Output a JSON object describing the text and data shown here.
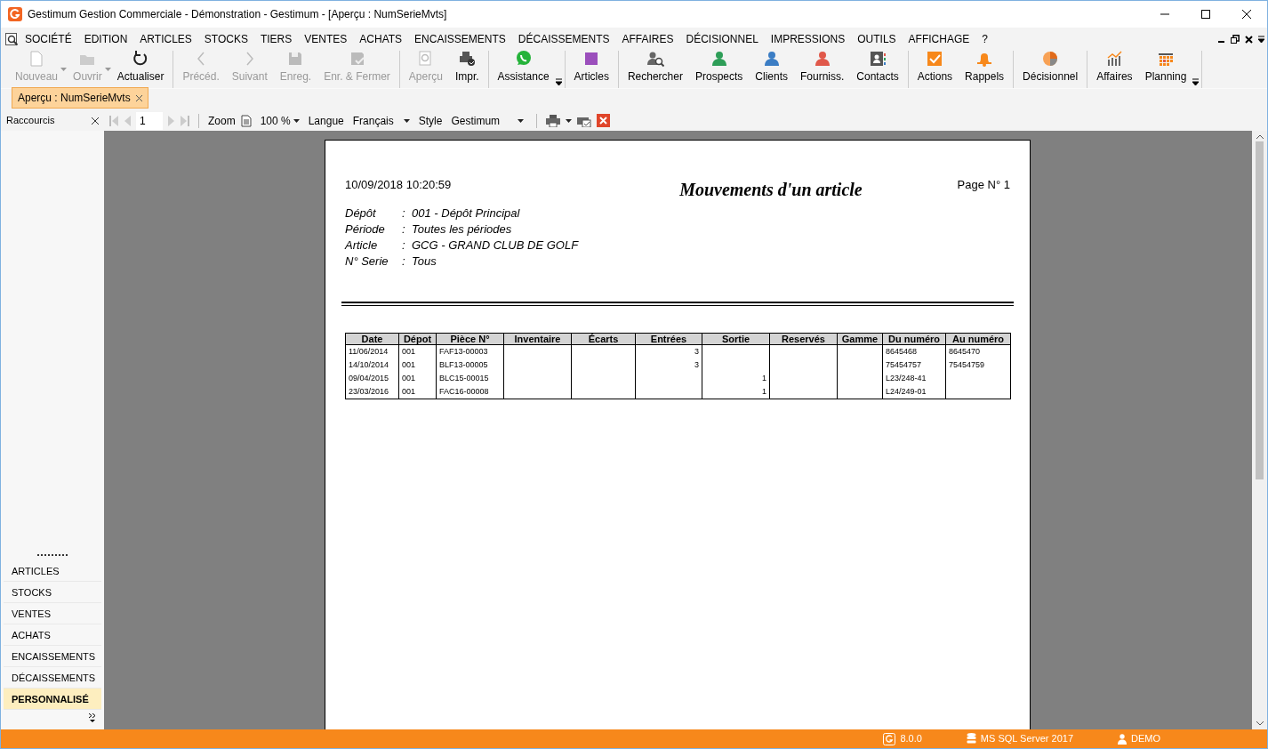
{
  "window": {
    "title": "Gestimum Gestion Commerciale - Démonstration - Gestimum - [Aperçu : NumSerieMvts]"
  },
  "menu": [
    "SOCIÉTÉ",
    "EDITION",
    "ARTICLES",
    "STOCKS",
    "TIERS",
    "VENTES",
    "ACHATS",
    "ENCAISSEMENTS",
    "DÉCAISSEMENTS",
    "AFFAIRES",
    "DÉCISIONNEL",
    "IMPRESSIONS",
    "OUTILS",
    "AFFICHAGE",
    "?"
  ],
  "toolbar": {
    "groups": [
      [
        {
          "label": "Nouveau",
          "disabled": true,
          "dropdown": true
        },
        {
          "label": "Ouvrir",
          "disabled": true,
          "dropdown": true
        },
        {
          "label": "Actualiser",
          "disabled": false,
          "dropdown": false
        }
      ],
      [
        {
          "label": "Précéd.",
          "disabled": true,
          "dropdown": false
        },
        {
          "label": "Suivant",
          "disabled": true,
          "dropdown": false
        },
        {
          "label": "Enreg.",
          "disabled": true,
          "dropdown": false
        },
        {
          "label": "Enr. & Fermer",
          "disabled": true,
          "dropdown": false
        }
      ],
      [
        {
          "label": "Aperçu",
          "disabled": true,
          "dropdown": false
        },
        {
          "label": "Impr.",
          "disabled": false,
          "dropdown": false
        }
      ],
      [
        {
          "label": "Assistance",
          "disabled": false,
          "dropdown": false
        }
      ],
      [
        {
          "label": "Articles",
          "disabled": false,
          "dropdown": false
        }
      ],
      [
        {
          "label": "Rechercher",
          "disabled": false,
          "dropdown": false
        },
        {
          "label": "Prospects",
          "disabled": false,
          "dropdown": false
        },
        {
          "label": "Clients",
          "disabled": false,
          "dropdown": false
        },
        {
          "label": "Fourniss.",
          "disabled": false,
          "dropdown": false
        },
        {
          "label": "Contacts",
          "disabled": false,
          "dropdown": false
        }
      ],
      [
        {
          "label": "Actions",
          "disabled": false,
          "dropdown": false
        },
        {
          "label": "Rappels",
          "disabled": false,
          "dropdown": false
        }
      ],
      [
        {
          "label": "Décisionnel",
          "disabled": false,
          "dropdown": false
        }
      ],
      [
        {
          "label": "Affaires",
          "disabled": false,
          "dropdown": false
        },
        {
          "label": "Planning",
          "disabled": false,
          "dropdown": false
        }
      ]
    ]
  },
  "doc_tabs": [
    {
      "label": "Aperçu : NumSerieMvts",
      "selected": true
    }
  ],
  "preview_toolbar": {
    "sidebar_title": "Raccourcis",
    "page": "1",
    "zoom_label": "Zoom",
    "zoom_value": "100 %",
    "language_label": "Langue",
    "language_value": "Français",
    "style_label": "Style",
    "style_value": "Gestimum"
  },
  "sidebar": {
    "items": [
      {
        "label": "ARTICLES",
        "selected": false
      },
      {
        "label": "STOCKS",
        "selected": false
      },
      {
        "label": "VENTES",
        "selected": false
      },
      {
        "label": "ACHATS",
        "selected": false
      },
      {
        "label": "ENCAISSEMENTS",
        "selected": false
      },
      {
        "label": "DÉCAISSEMENTS",
        "selected": false
      },
      {
        "label": "PERSONNALISÉ",
        "selected": true
      }
    ]
  },
  "report": {
    "date": "10/09/2018 10:20:59",
    "title": "Mouvements d'un article",
    "page": "Page N° 1",
    "params": [
      {
        "label": "Dépôt",
        "separator": ":",
        "value": "001 - Dépôt Principal"
      },
      {
        "label": "Période",
        "separator": ":",
        "value": "Toutes les périodes"
      },
      {
        "label": "Article",
        "separator": ":",
        "value": "GCG - GRAND CLUB DE GOLF"
      },
      {
        "label": "N° Serie",
        "separator": ":",
        "value": "Tous"
      }
    ],
    "columns": [
      {
        "label": "Date",
        "kind": "text"
      },
      {
        "label": "Dépot",
        "kind": "text"
      },
      {
        "label": "Pièce N°",
        "kind": "text"
      },
      {
        "label": "Inventaire",
        "kind": "number"
      },
      {
        "label": "Écarts",
        "kind": "number"
      },
      {
        "label": "Entrées",
        "kind": "number"
      },
      {
        "label": "Sortie",
        "kind": "number"
      },
      {
        "label": "Reservés",
        "kind": "number"
      },
      {
        "label": "Gamme",
        "kind": "text"
      },
      {
        "label": "Du numéro",
        "kind": "text"
      },
      {
        "label": "Au numéro",
        "kind": "text"
      }
    ],
    "rows": [
      [
        "11/06/2014",
        "001",
        "FAF13-00003",
        "",
        "",
        "3",
        "",
        "",
        "",
        "8645468",
        "8645470"
      ],
      [
        "14/10/2014",
        "001",
        "BLF13-00005",
        "",
        "",
        "3",
        "",
        "",
        "",
        "75454757",
        "75454759"
      ],
      [
        "09/04/2015",
        "001",
        "BLC15-00015",
        "",
        "",
        "",
        "1",
        "",
        "",
        "L23/248-41",
        ""
      ],
      [
        "23/03/2016",
        "001",
        "FAC16-00008",
        "",
        "",
        "",
        "1",
        "",
        "",
        "L24/249-01",
        ""
      ]
    ]
  },
  "status_bar": {
    "version": "8.0.0",
    "database": "MS SQL Server 2017",
    "user": "DEMO"
  }
}
